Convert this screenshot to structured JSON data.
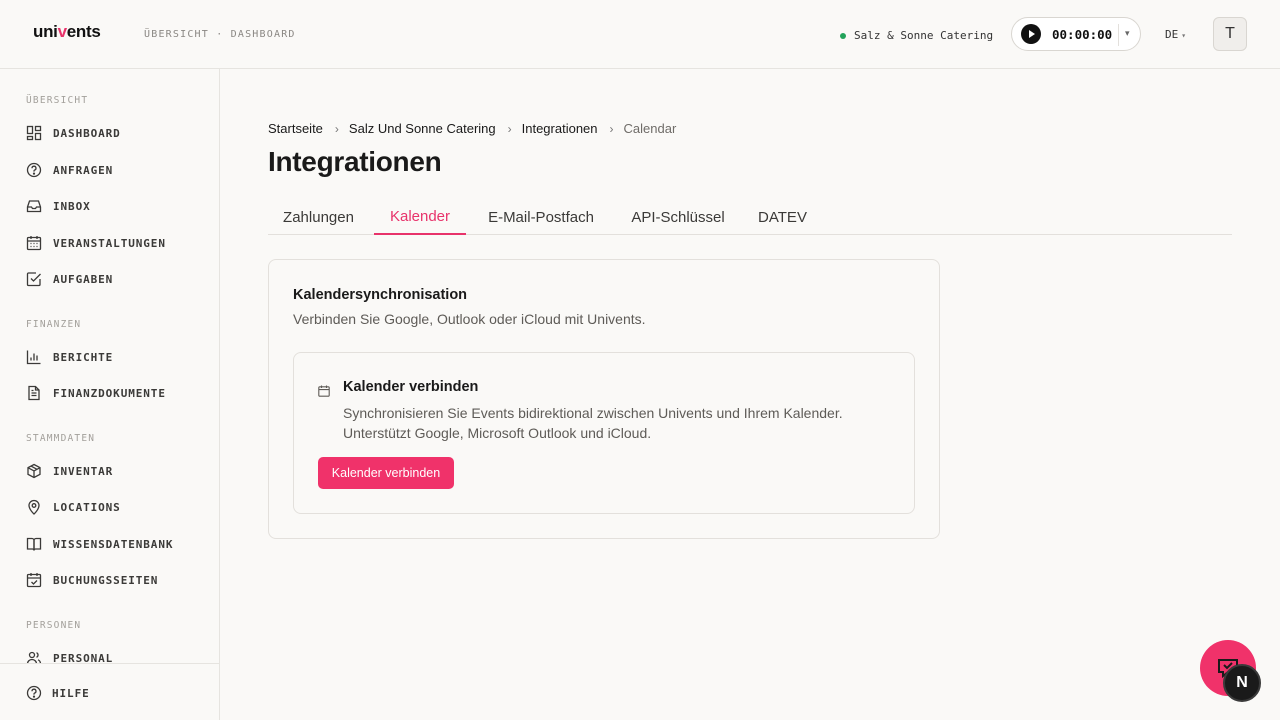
{
  "header": {
    "logo": {
      "pre": "uni",
      "accent": "v",
      "post": "ents"
    },
    "breadcrumb": "ÜBERSICHT · DASHBOARD",
    "tenant": "Salz & Sonne Catering",
    "timer": "00:00:00",
    "language": "DE",
    "avatar_initial": "T"
  },
  "sidebar": {
    "sections": {
      "overview": "ÜBERSICHT",
      "finance": "FINANZEN",
      "master": "STAMMDATEN",
      "people": "PERSONEN"
    },
    "items": {
      "dashboard": "DASHBOARD",
      "anfragen": "ANFRAGEN",
      "inbox": "INBOX",
      "veranstaltungen": "VERANSTALTUNGEN",
      "aufgaben": "AUFGABEN",
      "berichte": "BERICHTE",
      "finanzdokumente": "FINANZDOKUMENTE",
      "inventar": "INVENTAR",
      "locations": "LOCATIONS",
      "wissensdatenbank": "WISSENSDATENBANK",
      "buchungsseiten": "BUCHUNGSSEITEN",
      "personal": "PERSONAL",
      "hilfe": "HILFE"
    }
  },
  "main": {
    "breadcrumb": [
      "Startseite",
      "Salz Und Sonne Catering",
      "Integrationen",
      "Calendar"
    ],
    "title": "Integrationen",
    "tabs": [
      "Zahlungen",
      "Kalender",
      "E-Mail-Postfach",
      "API-Schlüssel",
      "DATEV"
    ],
    "active_tab": "Kalender",
    "card": {
      "title": "Kalendersynchronisation",
      "subtitle": "Verbinden Sie Google, Outlook oder iCloud mit Univents.",
      "inner_title": "Kalender verbinden",
      "inner_desc": "Synchronisieren Sie Events bidirektional zwischen Univents und Ihrem Kalender. Unterstützt Google, Microsoft Outlook und iCloud.",
      "button": "Kalender verbinden"
    }
  },
  "floating": {
    "badge": "N"
  },
  "colors": {
    "accent": "#f0326a",
    "status": "#22a35a"
  }
}
